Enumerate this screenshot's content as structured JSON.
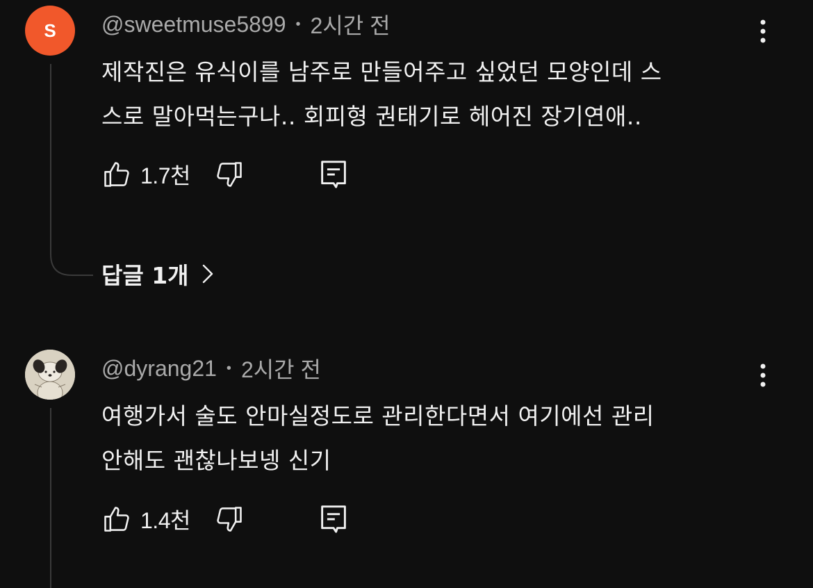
{
  "comments": [
    {
      "avatar_letter": "S",
      "avatar_color": "#f1582b",
      "username": "@sweetmuse5899",
      "time": "2시간 전",
      "separator": "•",
      "lines": [
        "제작진은 유식이를 남주로 만들어주고 싶었던 모양인데 스",
        "스로 말아먹는구나.. 회피형 권태기로 헤어진 장기연애.."
      ],
      "likes": "1.7천",
      "replies_label": "답글 1개"
    },
    {
      "username": "@dyrang21",
      "time": "2시간 전",
      "separator": "•",
      "lines": [
        "여행가서 술도 안마실정도로 관리한다면서 여기에선 관리",
        "안해도 괜찮나보넹 신기"
      ],
      "likes": "1.4천"
    }
  ],
  "icons": {
    "like": "thumbs-up-icon",
    "dislike": "thumbs-down-icon",
    "reply": "comment-icon",
    "more": "more-vertical-icon",
    "chevron": "chevron-right-icon"
  }
}
